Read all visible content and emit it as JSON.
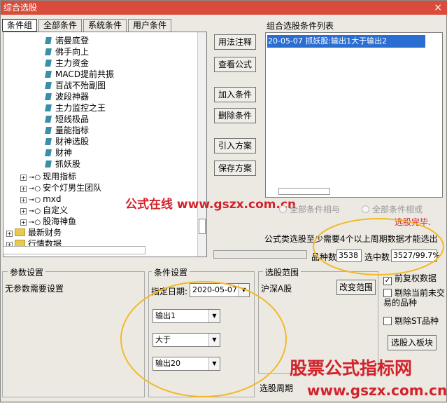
{
  "window": {
    "title": "综合选股",
    "close": "×"
  },
  "tabs": [
    {
      "label": "条件组"
    },
    {
      "label": "全部条件"
    },
    {
      "label": "系统条件"
    },
    {
      "label": "用户条件"
    }
  ],
  "tree": {
    "leaf_items": [
      "诺曼底登",
      "佛手向上",
      "主力资金",
      "MACD提前共振",
      "百战不殆副图",
      "波段神器",
      "主力监控之王",
      "短线极品",
      "量能指标",
      "财神选股",
      "财神",
      "抓妖股"
    ],
    "key_items": [
      "现用指标",
      "安个灯男生团队",
      "mxd",
      "自定义",
      "股海神鱼"
    ],
    "folder_items": [
      "最新财务",
      "行情数据"
    ]
  },
  "buttons": {
    "usage": "用法注释",
    "view_formula": "查看公式",
    "add_cond": "加入条件",
    "del_cond": "删除条件",
    "import_plan": "引入方案",
    "save_plan": "保存方案",
    "change_range": "改变范围",
    "select_to_board": "选股入板块"
  },
  "cond_list": {
    "title": "组合选股条件列表",
    "rows": [
      "20-05-07 抓妖股:输出1大于输出2"
    ]
  },
  "watermark_top": "公式在线 www.gszx.com.cn",
  "radios": {
    "all_and": "全部条件相与",
    "all_or": "全部条件相或"
  },
  "status": {
    "done": "选股完毕.",
    "note": "公式类选股至少需要4个以上周期数据才能选出",
    "count_label": "品种数",
    "count_value": "3538",
    "hit_label": "选中数",
    "hit_value": "3527/99.7%"
  },
  "params": {
    "title": "参数设置",
    "text": "无参数需要设置"
  },
  "condset": {
    "title": "条件设置",
    "date_label": "指定日期:",
    "date_value": "2020-05-07",
    "out1": "输出1",
    "op": "大于",
    "out2": "输出20"
  },
  "range": {
    "title": "选股范围",
    "value": "沪深A股",
    "period_label": "选股周期"
  },
  "checks": {
    "pre_adjust": "前复权数据",
    "exclude_untraded": "剔除当前未交易的品种",
    "exclude_st": "剔除ST品种"
  },
  "watermark_bottom": {
    "line1": "股票公式指标网",
    "line2": "www.gszx.com.cn"
  },
  "colors": {
    "title": "#d94c3c",
    "select": "#2a6ed1",
    "red": "#d2222a",
    "annotation": "#f2b927"
  }
}
